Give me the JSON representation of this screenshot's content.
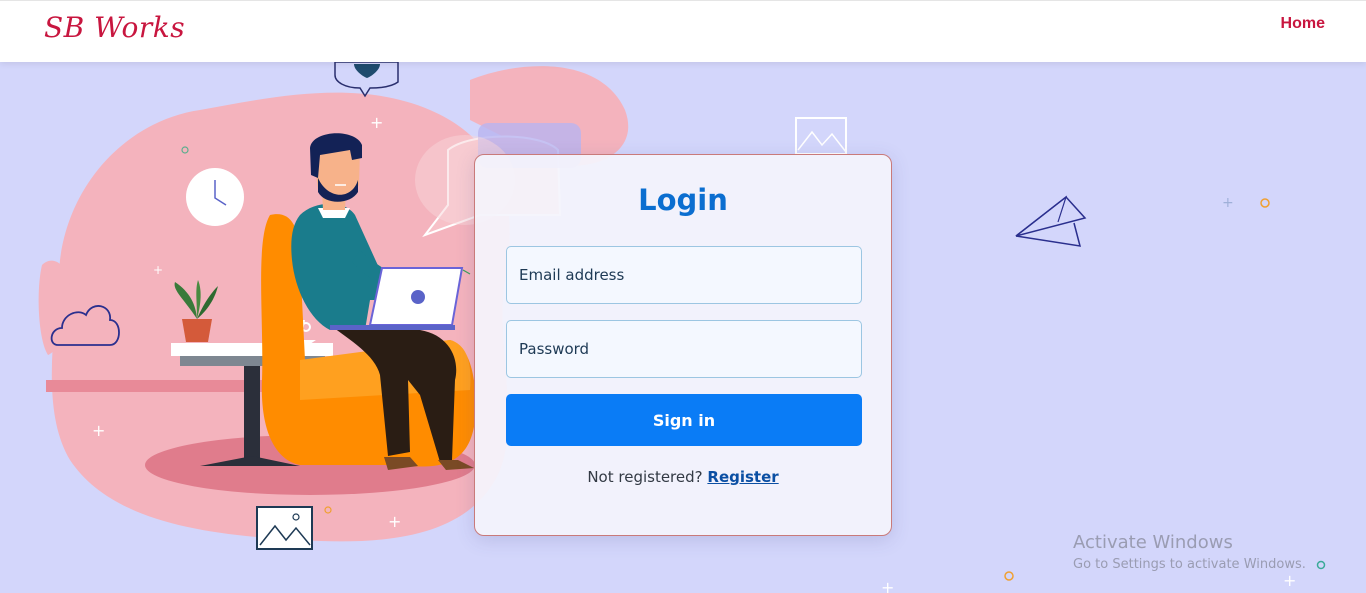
{
  "navbar": {
    "brand": "SB Works",
    "home_label": "Home"
  },
  "login": {
    "title": "Login",
    "email_placeholder": "Email address",
    "password_placeholder": "Password",
    "signin_label": "Sign in",
    "not_registered_text": "Not registered?",
    "register_label": "Register"
  },
  "watermark": {
    "title": "Activate Windows",
    "subtitle": "Go to Settings to activate Windows."
  },
  "colors": {
    "background": "#d3d6fb",
    "brand": "#c8163f",
    "title": "#0b6ed0",
    "button": "#0a7cf6"
  },
  "icons": [
    "cloud-icon",
    "clock-icon",
    "paper-plane-icon",
    "image-frame-icon",
    "chat-bubble-icon",
    "plant-icon",
    "laptop-icon"
  ]
}
